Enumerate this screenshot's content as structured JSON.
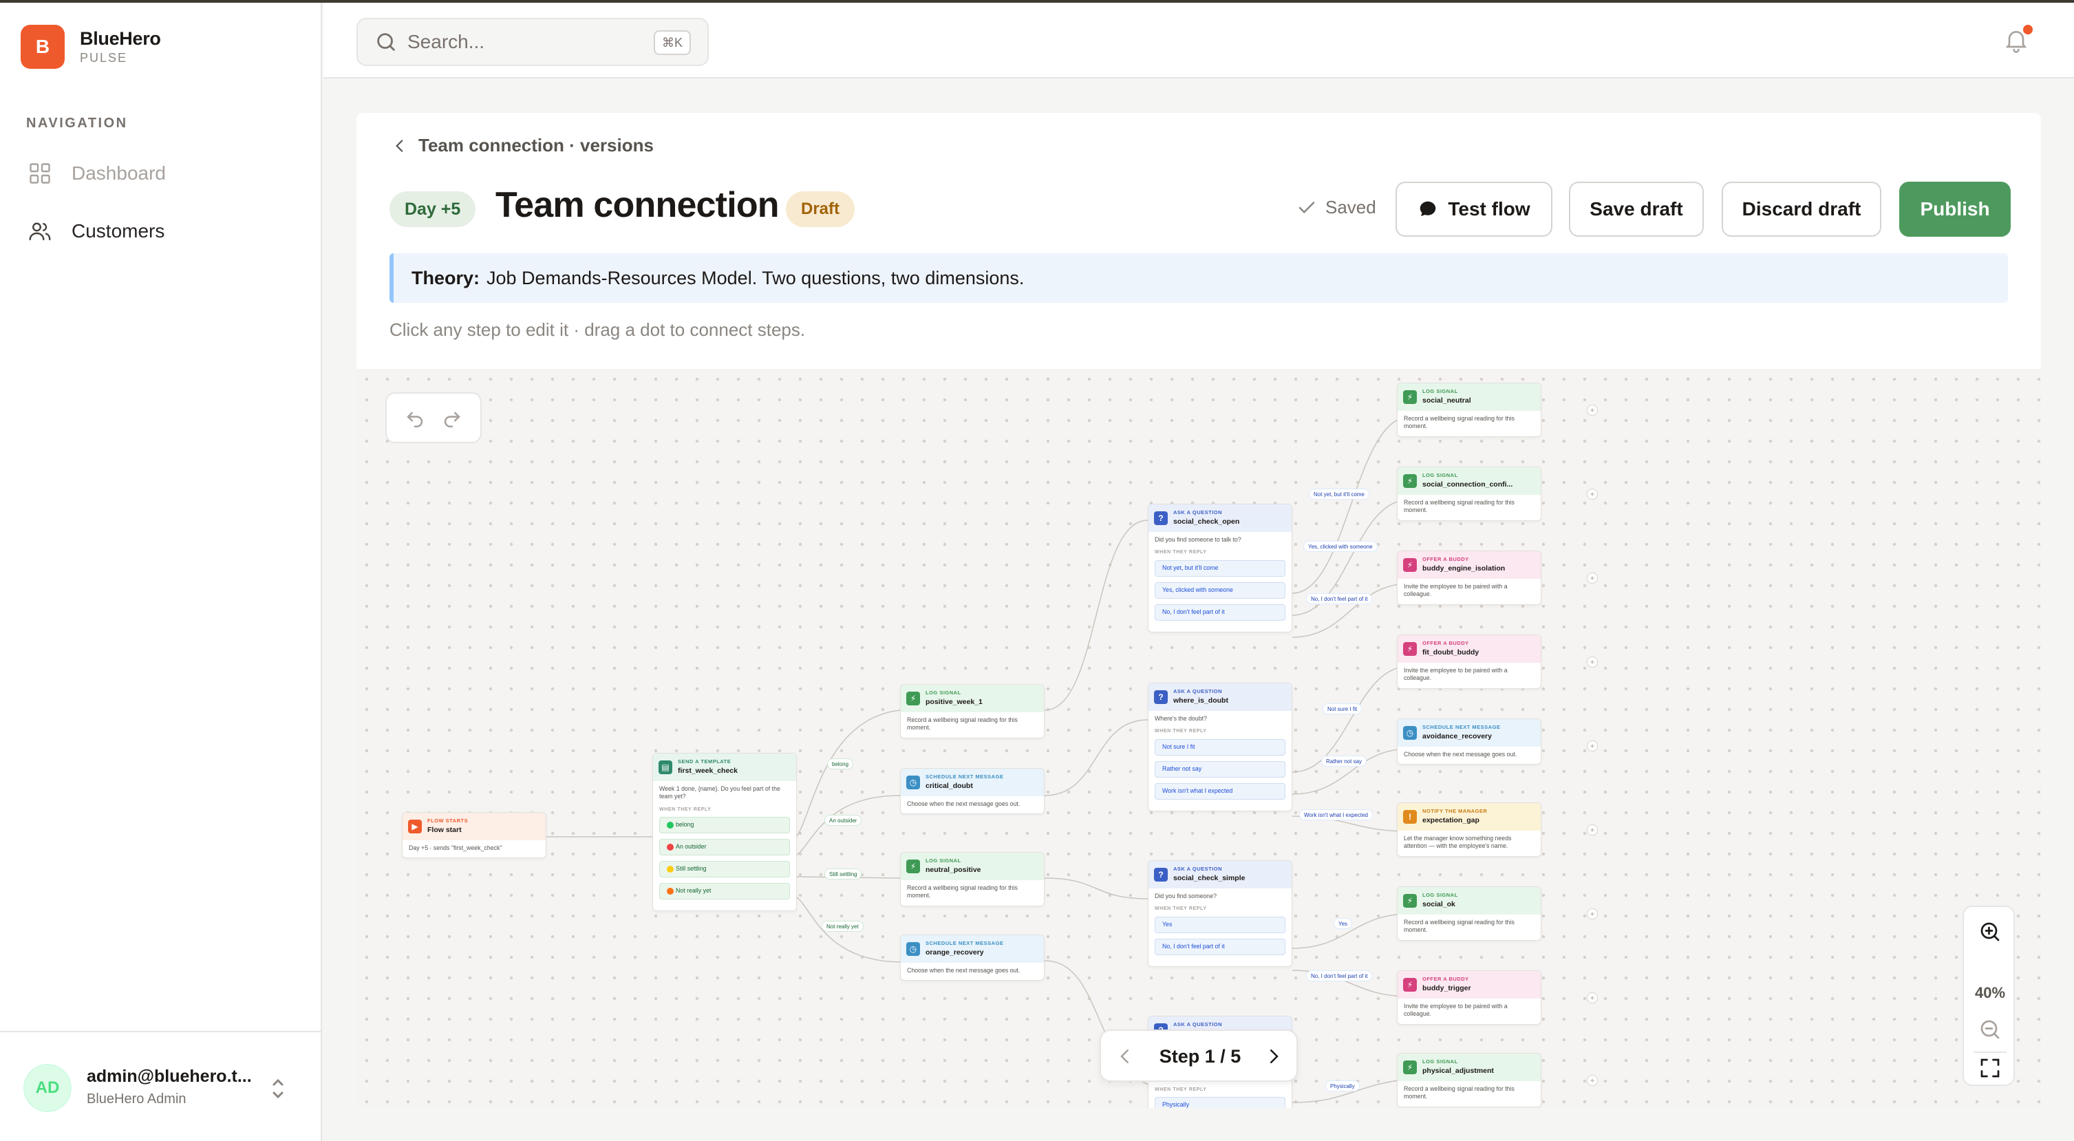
{
  "brand": {
    "logo_letter": "B",
    "name": "BlueHero",
    "sub": "PULSE",
    "accent": "#ef5a2c"
  },
  "sidebar": {
    "nav_label": "NAVIGATION",
    "items": [
      {
        "label": "Dashboard",
        "icon": "grid-icon",
        "state": "muted"
      },
      {
        "label": "Customers",
        "icon": "users-icon",
        "state": "normal"
      }
    ]
  },
  "user": {
    "initials": "AD",
    "email": "admin@bluehero.t...",
    "role": "BlueHero Admin"
  },
  "topbar": {
    "search_placeholder": "Search...",
    "shortcut": "⌘K"
  },
  "page": {
    "breadcrumb": "Team connection · versions",
    "day_badge": "Day +5",
    "title": "Team connection",
    "status_badge": "Draft",
    "saved_label": "Saved",
    "buttons": {
      "test": "Test flow",
      "save": "Save draft",
      "discard": "Discard draft",
      "publish": "Publish"
    },
    "publish_color": "#4e9a5e",
    "theory_label": "Theory:",
    "theory_text": "Job Demands-Resources Model. Two questions, two dimensions.",
    "hint": "Click any step to edit it · drag a dot to connect steps."
  },
  "canvas": {
    "zoom_level": "40%",
    "stepper": "Step 1 / 5",
    "reply_heading": "WHEN THEY REPLY",
    "nodes": {
      "start": {
        "kind": "FLOW STARTS",
        "name": "Flow start",
        "body": "Day +5 · sends \"first_week_check\""
      },
      "template": {
        "kind": "SEND A TEMPLATE",
        "name": "first_week_check",
        "body": "Week 1 done, {name}. Do you feel part of the team yet?",
        "replies": [
          "belong",
          "An outsider",
          "Still settling",
          "Not really yet"
        ]
      },
      "positive_week_1": {
        "kind": "LOG SIGNAL",
        "name": "positive_week_1",
        "body": "Record a wellbeing signal reading for this moment."
      },
      "critical_doubt": {
        "kind": "SCHEDULE NEXT MESSAGE",
        "name": "critical_doubt",
        "body": "Choose when the next message goes out."
      },
      "neutral_positive": {
        "kind": "LOG SIGNAL",
        "name": "neutral_positive",
        "body": "Record a wellbeing signal reading for this moment."
      },
      "orange_recovery": {
        "kind": "SCHEDULE NEXT MESSAGE",
        "name": "orange_recovery",
        "body": "Choose when the next message goes out."
      },
      "social_check_open": {
        "kind": "ASK A QUESTION",
        "name": "social_check_open",
        "body": "Did you find someone to talk to?",
        "replies": [
          "Not yet, but it'll come",
          "Yes, clicked with someone",
          "No, I don't feel part of it"
        ]
      },
      "where_is_doubt": {
        "kind": "ASK A QUESTION",
        "name": "where_is_doubt",
        "body": "Where's the doubt?",
        "replies": [
          "Not sure I fit",
          "Rather not say",
          "Work isn't what I expected"
        ]
      },
      "social_check_simple": {
        "kind": "ASK A QUESTION",
        "name": "social_check_simple",
        "body": "Did you find someone?",
        "replies": [
          "Yes",
          "No, I don't feel part of it"
        ]
      },
      "bottom_ask": {
        "kind": "ASK A QUESTION",
        "reply": "Physically"
      },
      "social_neutral": {
        "kind": "LOG SIGNAL",
        "name": "social_neutral",
        "body": "Record a wellbeing signal reading for this moment."
      },
      "social_connection": {
        "kind": "LOG SIGNAL",
        "name": "social_connection_confi...",
        "body": "Record a wellbeing signal reading for this moment."
      },
      "buddy_engine_isolation": {
        "kind": "OFFER A BUDDY",
        "name": "buddy_engine_isolation",
        "body": "Invite the employee to be paired with a colleague."
      },
      "fit_doubt_buddy": {
        "kind": "OFFER A BUDDY",
        "name": "fit_doubt_buddy",
        "body": "Invite the employee to be paired with a colleague."
      },
      "avoidance_recovery": {
        "kind": "SCHEDULE NEXT MESSAGE",
        "name": "avoidance_recovery",
        "body": "Choose when the next message goes out."
      },
      "expectation_gap": {
        "kind": "NOTIFY THE MANAGER",
        "name": "expectation_gap",
        "body": "Let the manager know something needs attention — with the employee's name."
      },
      "social_ok": {
        "kind": "LOG SIGNAL",
        "name": "social_ok",
        "body": "Record a wellbeing signal reading for this moment."
      },
      "buddy_trigger": {
        "kind": "OFFER A BUDDY",
        "name": "buddy_trigger",
        "body": "Invite the employee to be paired with a colleague."
      },
      "physical_adjustment": {
        "kind": "LOG SIGNAL",
        "name": "physical_adjustment",
        "body": "Record a wellbeing signal reading for this moment."
      }
    },
    "edge_labels": {
      "belong": "belong",
      "outsider": "An outsider",
      "settling": "Still settling",
      "not_yet": "Not really yet",
      "not_yet_come": "Not yet, but it'll come",
      "yes_clicked": "Yes, clicked with someone",
      "no_part": "No, I don't feel part of it",
      "not_sure": "Not sure I fit",
      "rather": "Rather not say",
      "work_isnt": "Work isn't what I expected",
      "yes": "Yes",
      "no_part_2": "No, I don't feel part of it",
      "physically": "Physically"
    }
  }
}
